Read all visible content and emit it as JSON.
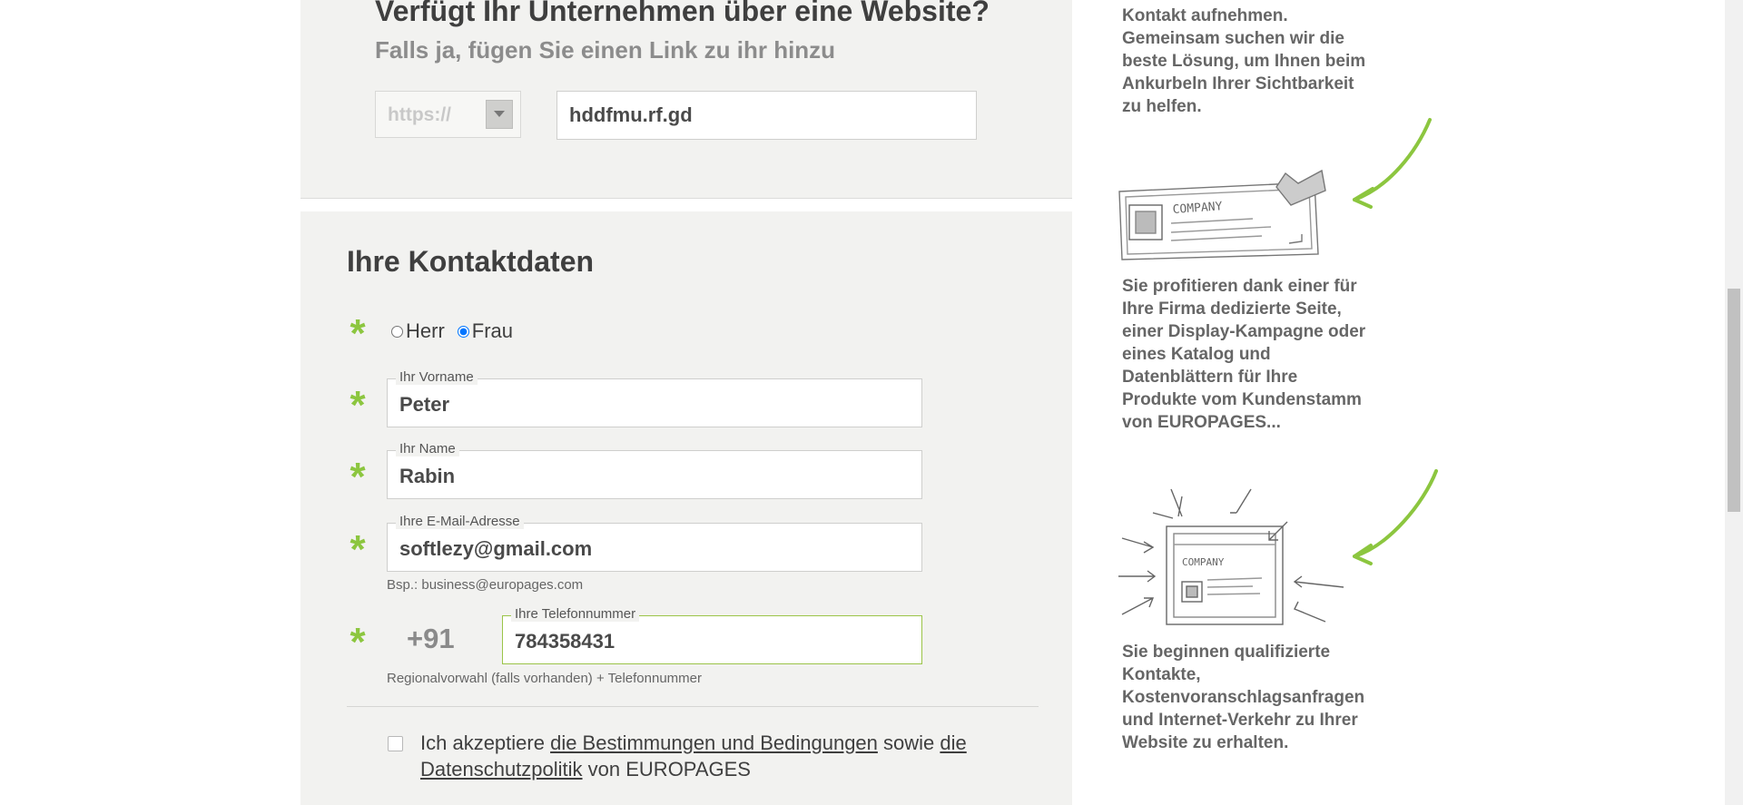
{
  "website": {
    "title": "Verfügt Ihr Unternehmen über eine Website?",
    "subtitle": "Falls ja, fügen Sie einen Link zu ihr hinzu",
    "protocol_value": "https://",
    "url_value": "hddfmu.rf.gd"
  },
  "contact": {
    "title": "Ihre Kontaktdaten",
    "required_mark": "*",
    "salutation": {
      "options": [
        "Herr",
        "Frau"
      ],
      "selected": "Frau"
    },
    "first_name": {
      "label": "Ihr Vorname",
      "value": "Peter"
    },
    "last_name": {
      "label": "Ihr Name",
      "value": "Rabin"
    },
    "email": {
      "label": "Ihre E-Mail-Adresse",
      "value": "softlezy@gmail.com",
      "hint": "Bsp.: business@europages.com"
    },
    "phone": {
      "prefix": "+91",
      "label": "Ihre Telefonnummer",
      "value": "784358431",
      "hint": "Regionalvorwahl (falls vorhanden) + Telefonnummer"
    }
  },
  "terms": {
    "text_1": "Ich akzeptiere ",
    "link_1": "die Bestimmungen und Bedingungen",
    "text_2": " sowie ",
    "link_2a": "die",
    "link_2b": "Datenschutzpolitik",
    "text_3": " von EUROPAGES"
  },
  "sidebar": {
    "text_top": "Unser Team wird mit Ihnen Kontakt aufnehmen. Gemeinsam suchen wir die beste Lösung, um Ihnen beim Ankurbeln Ihrer Sichtbarkeit zu helfen.",
    "text_middle": "Sie profitieren dank einer für Ihre Firma dedizierte Seite, einer Display-Kampagne oder eines Katalog und Datenblättern für Ihre Produkte vom Kundenstamm von EUROPAGES...",
    "text_bottom": "Sie beginnen qualifizierte Kontakte, Kostenvoranschlagsanfragen und Internet-Verkehr zu Ihrer Website zu erhalten.",
    "sketch_label": "COMPANY"
  },
  "colors": {
    "accent": "#8cc63f",
    "panel": "#f2f2f0",
    "focus_border": "#9bc448"
  },
  "icons": [
    "chevron-down-icon",
    "required-asterisk-icon",
    "green-arrow-icon"
  ]
}
